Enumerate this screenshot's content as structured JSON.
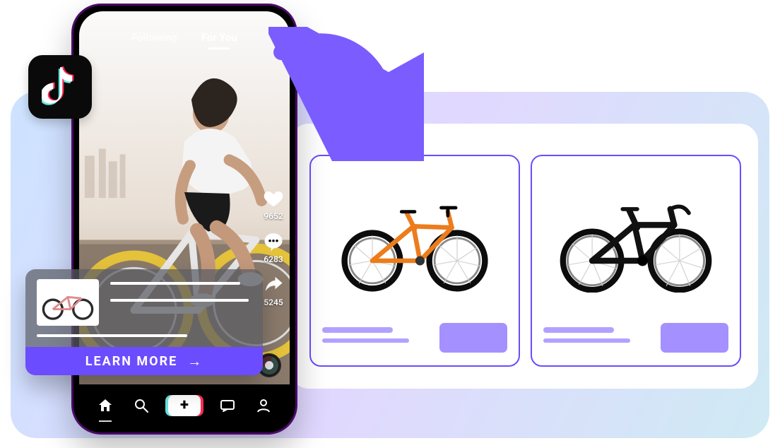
{
  "feed": {
    "tabs": {
      "following": "Following",
      "for_you": "For You",
      "active": "for_you"
    },
    "counters": {
      "likes": "9652",
      "comments": "6283",
      "shares": "5245"
    }
  },
  "overlay": {
    "cta_label": "LEARN MORE"
  },
  "products": [
    {
      "name": "bike-orange",
      "color": "#ec7c1c"
    },
    {
      "name": "bike-black",
      "color": "#111111"
    }
  ],
  "brand": {
    "badge": "tiktok"
  },
  "colors": {
    "accent": "#6C4CFF"
  }
}
